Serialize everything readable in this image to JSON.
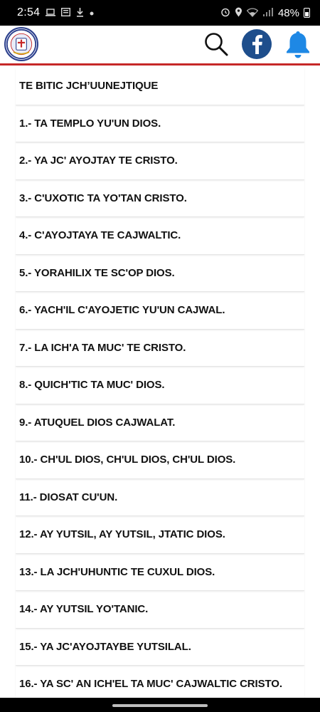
{
  "status_bar": {
    "time": "2:54",
    "battery": "48%"
  },
  "list": {
    "heading": "TE BITIC JCH’UUNEJTIQUE",
    "items": [
      "1.- TA TEMPLO YU'UN DIOS.",
      "2.- YA JC' AYOJTAY TE CRISTO.",
      "3.- C'UXOTIC TA YO'TAN CRISTO.",
      "4.- C'AYOJTAYA TE CAJWALTIC.",
      "5.- YORAHILIX TE SC'OP DIOS.",
      "6.- YACH'IL C'AYOJETIC YU'UN CAJWAL.",
      "7.- LA ICH'A TA MUC' TE CRISTO.",
      "8.- QUICH'TIC TA MUC' DIOS.",
      "9.- ATUQUEL DIOS CAJWALAT.",
      "10.- CH'UL DIOS, CH'UL DIOS, CH'UL DIOS.",
      "11.- DIOSAT CU'UN.",
      "12.- AY YUTSIL, AY YUTSIL, JTATIC DIOS.",
      "13.- LA JCH'UHUNTIC TE CUXUL DIOS.",
      "14.- AY YUTSIL YO'TANIC.",
      "15.- YA JC'AYOJTAYBE YUTSILAL.",
      "16.- YA SC' AN ICH'EL TA MUC' CAJWALTIC CRISTO."
    ]
  },
  "colors": {
    "header_accent": "#c62828",
    "facebook": "#1e4e8c",
    "bell": "#1e88e5"
  }
}
